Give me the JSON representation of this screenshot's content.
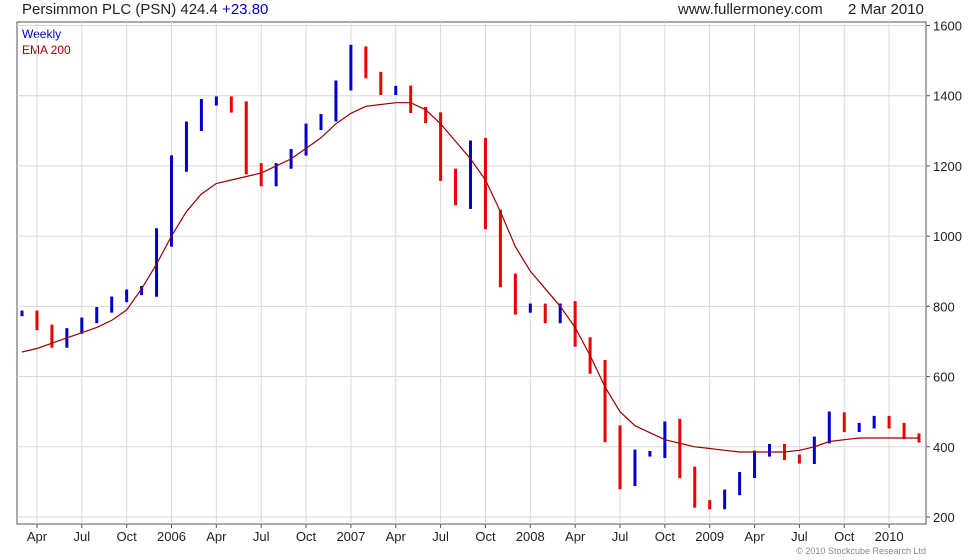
{
  "header": {
    "title": "Persimmon PLC (PSN) 424.4",
    "change": "+23.80",
    "site": "www.fullermoney.com",
    "date": "2 Mar 2010"
  },
  "legend": {
    "primary": "Weekly",
    "secondary": "EMA 200"
  },
  "copyright": "© 2010 Stockcube Research Ltd",
  "colors": {
    "up": "#0000cc",
    "down": "#ee0000",
    "ema": "#990000",
    "grid": "#d8d8d8",
    "change": "#0000cc"
  },
  "chart_data": {
    "type": "line",
    "title": "Persimmon PLC (PSN) 424.4 +23.80",
    "xlabel": "",
    "ylabel": "",
    "ylim": [
      180,
      1610
    ],
    "yticks": [
      200,
      400,
      600,
      800,
      1000,
      1200,
      1400,
      1600
    ],
    "xticks": [
      "Apr",
      "Jul",
      "Oct",
      "2006",
      "Apr",
      "Jul",
      "Oct",
      "2007",
      "Apr",
      "Jul",
      "Oct",
      "2008",
      "Apr",
      "Jul",
      "Oct",
      "2009",
      "Apr",
      "Jul",
      "Oct",
      "2010"
    ],
    "grid": true,
    "legend_position": "top-left",
    "series": [
      {
        "name": "Weekly",
        "style": "weekly high-low bars",
        "x": [
          "2005-03",
          "2005-04",
          "2005-05",
          "2005-06",
          "2005-07",
          "2005-08",
          "2005-09",
          "2005-10",
          "2005-11",
          "2005-12",
          "2006-01",
          "2006-02",
          "2006-03",
          "2006-04",
          "2006-05",
          "2006-06",
          "2006-07",
          "2006-08",
          "2006-09",
          "2006-10",
          "2006-11",
          "2006-12",
          "2007-01",
          "2007-02",
          "2007-03",
          "2007-04",
          "2007-05",
          "2007-06",
          "2007-07",
          "2007-08",
          "2007-09",
          "2007-10",
          "2007-11",
          "2007-12",
          "2008-01",
          "2008-02",
          "2008-03",
          "2008-04",
          "2008-05",
          "2008-06",
          "2008-07",
          "2008-08",
          "2008-09",
          "2008-10",
          "2008-11",
          "2008-12",
          "2009-01",
          "2009-02",
          "2009-03",
          "2009-04",
          "2009-05",
          "2009-06",
          "2009-07",
          "2009-08",
          "2009-09",
          "2009-10",
          "2009-11",
          "2009-12",
          "2010-01",
          "2010-02",
          "2010-03"
        ],
        "values": [
          780,
          740,
          690,
          730,
          760,
          790,
          820,
          840,
          850,
          1000,
          1200,
          1310,
          1380,
          1390,
          1360,
          1200,
          1150,
          1200,
          1240,
          1310,
          1340,
          1430,
          1530,
          1460,
          1410,
          1420,
          1360,
          1330,
          1180,
          1100,
          1250,
          1050,
          880,
          790,
          800,
          760,
          800,
          700,
          620,
          440,
          300,
          380,
          380,
          460,
          330,
          240,
          230,
          270,
          320,
          380,
          400,
          370,
          360,
          420,
          490,
          450,
          460,
          480,
          460,
          430,
          420
        ]
      },
      {
        "name": "EMA 200",
        "x": [
          "2005-03",
          "2005-04",
          "2005-05",
          "2005-06",
          "2005-07",
          "2005-08",
          "2005-09",
          "2005-10",
          "2005-11",
          "2005-12",
          "2006-01",
          "2006-02",
          "2006-03",
          "2006-04",
          "2006-05",
          "2006-06",
          "2006-07",
          "2006-08",
          "2006-09",
          "2006-10",
          "2006-11",
          "2006-12",
          "2007-01",
          "2007-02",
          "2007-03",
          "2007-04",
          "2007-05",
          "2007-06",
          "2007-07",
          "2007-08",
          "2007-09",
          "2007-10",
          "2007-11",
          "2007-12",
          "2008-01",
          "2008-02",
          "2008-03",
          "2008-04",
          "2008-05",
          "2008-06",
          "2008-07",
          "2008-08",
          "2008-09",
          "2008-10",
          "2008-11",
          "2008-12",
          "2009-01",
          "2009-02",
          "2009-03",
          "2009-04",
          "2009-05",
          "2009-06",
          "2009-07",
          "2009-08",
          "2009-09",
          "2009-10",
          "2009-11",
          "2009-12",
          "2010-01",
          "2010-02",
          "2010-03"
        ],
        "values": [
          670,
          680,
          695,
          710,
          725,
          740,
          760,
          790,
          850,
          920,
          1000,
          1070,
          1120,
          1150,
          1160,
          1170,
          1180,
          1200,
          1220,
          1250,
          1280,
          1320,
          1350,
          1370,
          1375,
          1380,
          1380,
          1360,
          1320,
          1270,
          1220,
          1160,
          1070,
          970,
          900,
          850,
          800,
          740,
          660,
          570,
          500,
          460,
          440,
          420,
          410,
          400,
          395,
          390,
          385,
          385,
          385,
          385,
          390,
          400,
          415,
          420,
          425,
          425,
          425,
          425,
          425
        ]
      }
    ]
  }
}
